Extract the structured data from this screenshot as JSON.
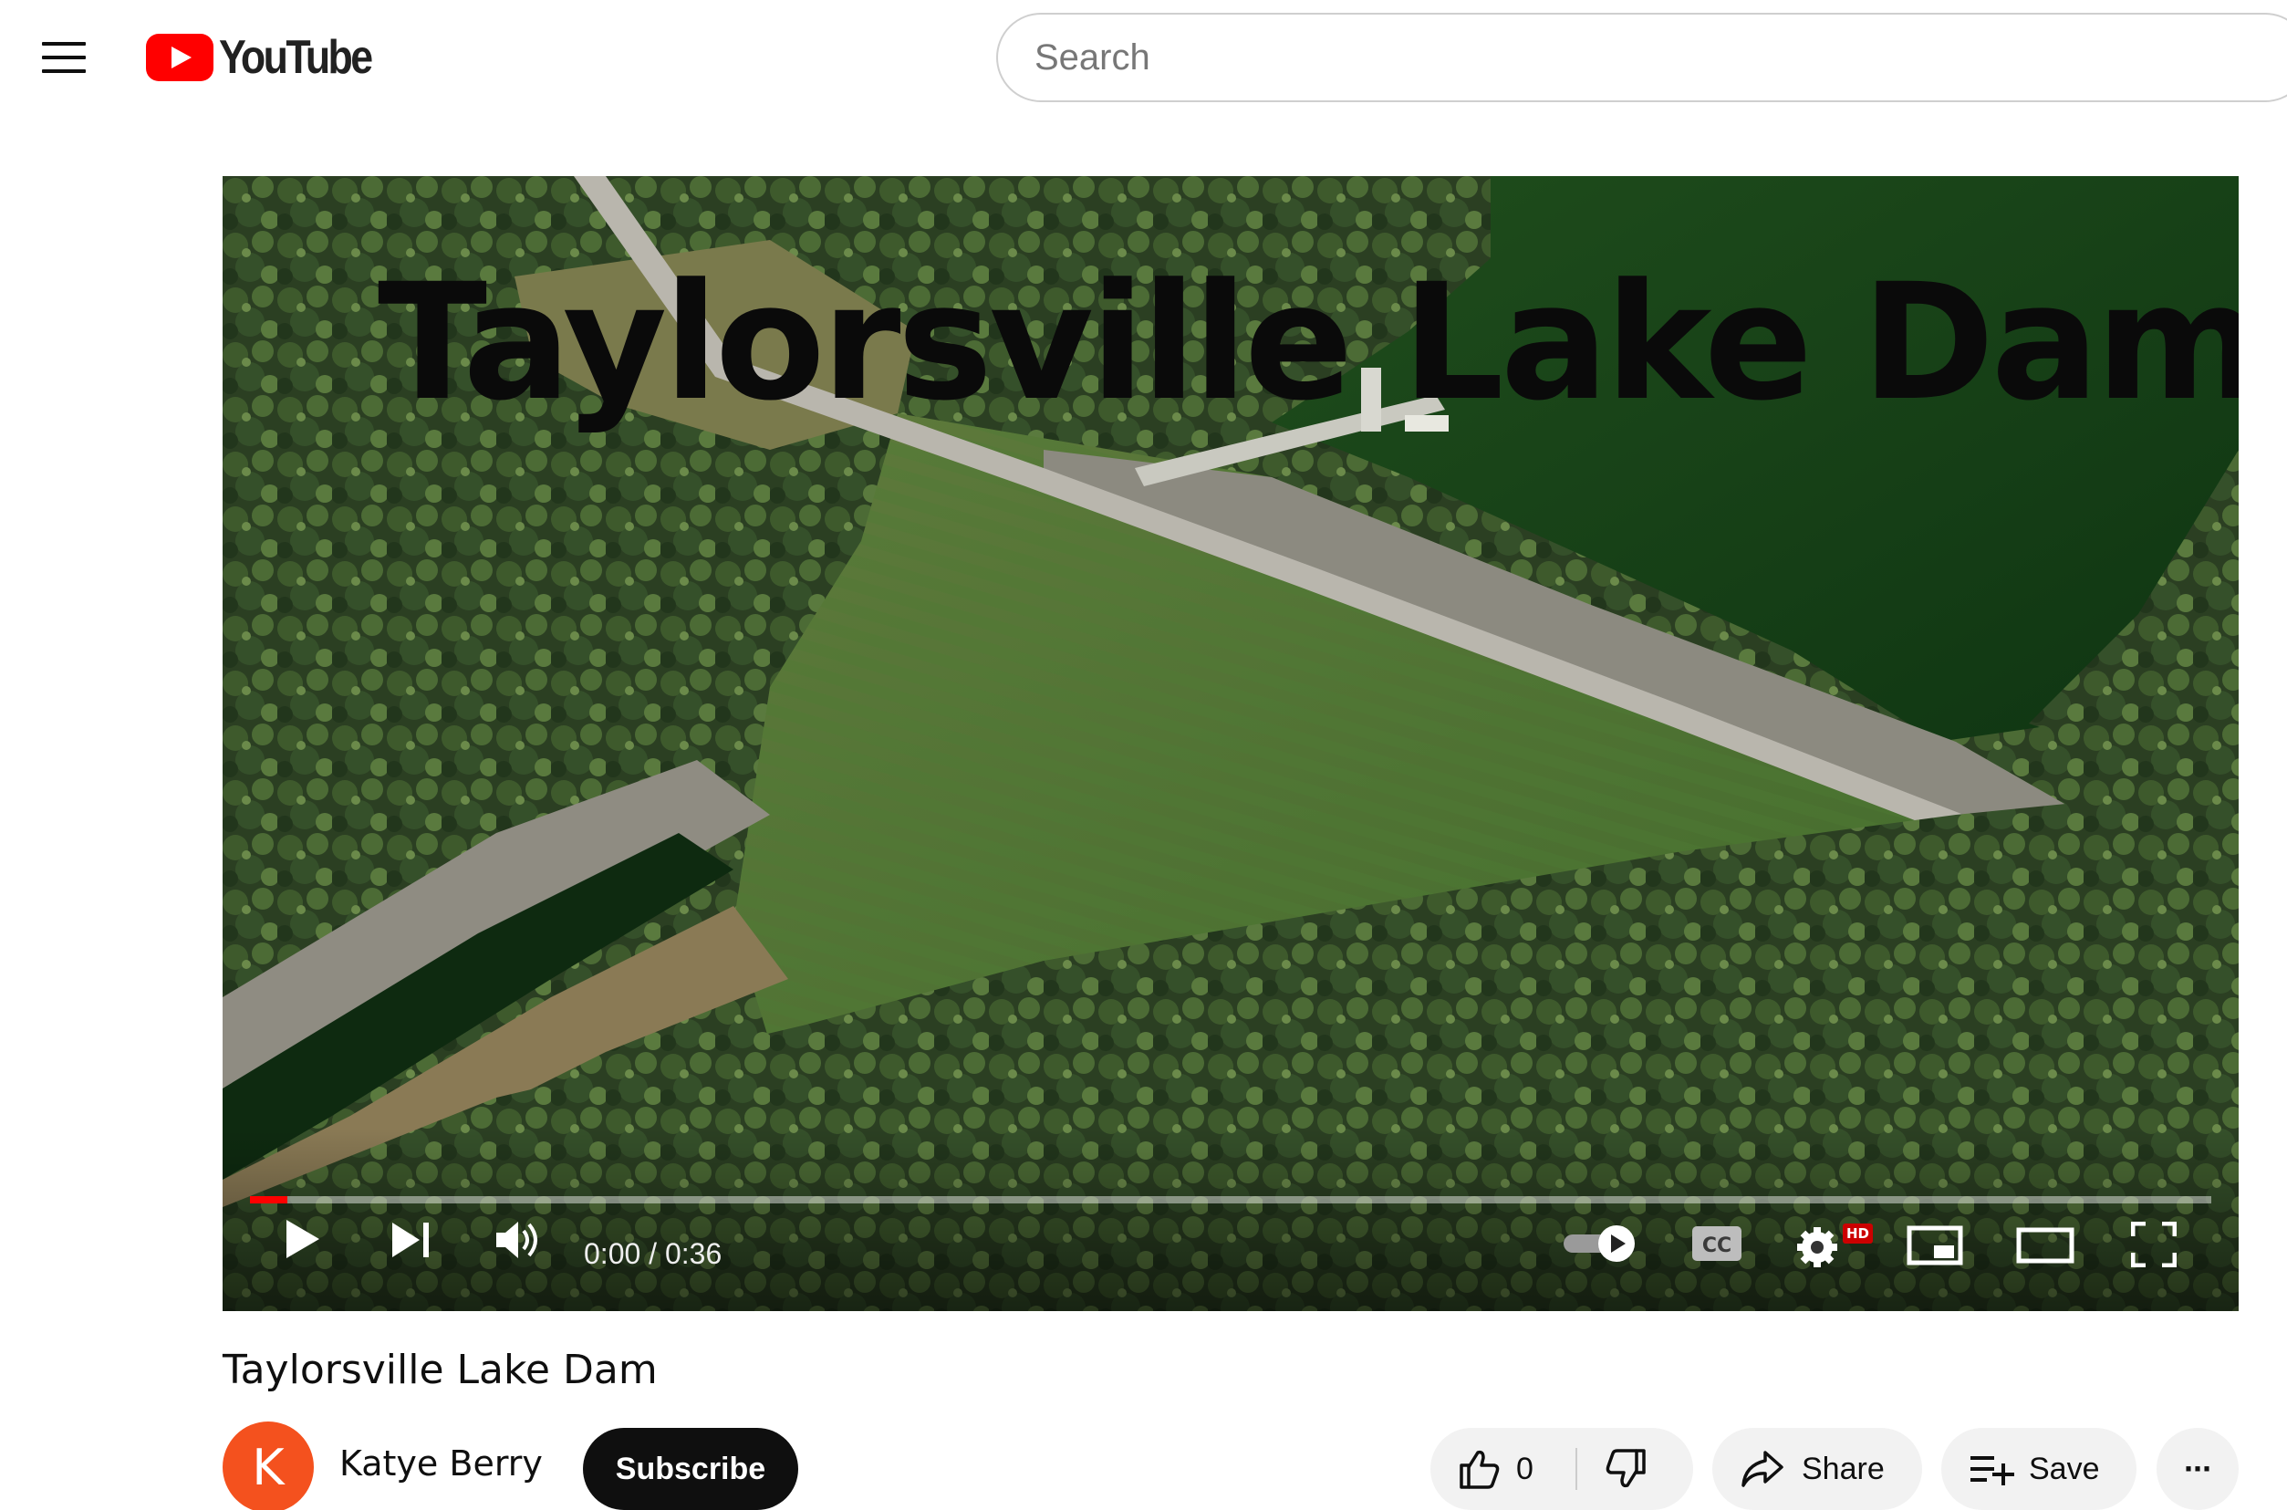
{
  "header": {
    "logo_text": "YouTube",
    "search_placeholder": "Search"
  },
  "player": {
    "overlay_title": "Taylorsville Lake Dam",
    "current_time": "0:00",
    "time_separator": " / ",
    "duration": "0:36",
    "progress_fraction": 0.019,
    "hd_badge": "HD",
    "cc_label": "CC",
    "autoplay_on": true
  },
  "video": {
    "title": "Taylorsville Lake Dam"
  },
  "channel": {
    "avatar_letter": "K",
    "avatar_color": "#f4511e",
    "name": "Katye Berry",
    "subscribe_label": "Subscribe"
  },
  "actions": {
    "like_count": "0",
    "share_label": "Share",
    "save_label": "Save",
    "more_label": "···"
  },
  "colors": {
    "brand_red": "#ff0000",
    "button_bg": "#f2f2f2",
    "text": "#0f0f0f"
  }
}
